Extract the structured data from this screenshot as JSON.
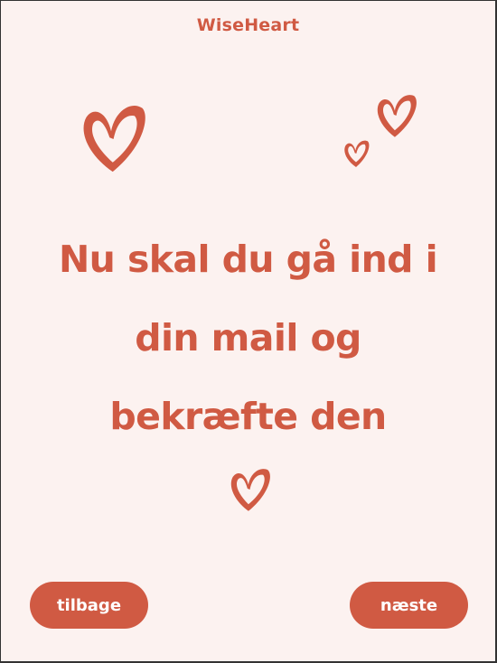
{
  "app": {
    "brand": "WiseHeart"
  },
  "main": {
    "heading_lines": [
      "Nu skal du gå ind i",
      "din mail og",
      "bekræfte den"
    ]
  },
  "nav": {
    "back_label": "tilbage",
    "next_label": "næste"
  },
  "colors": {
    "accent": "#D05A43",
    "background": "#FCF2F0",
    "frame": "#333333",
    "button_text": "#FFFFFF"
  },
  "icons": {
    "decor": "heart-outline-icon"
  }
}
